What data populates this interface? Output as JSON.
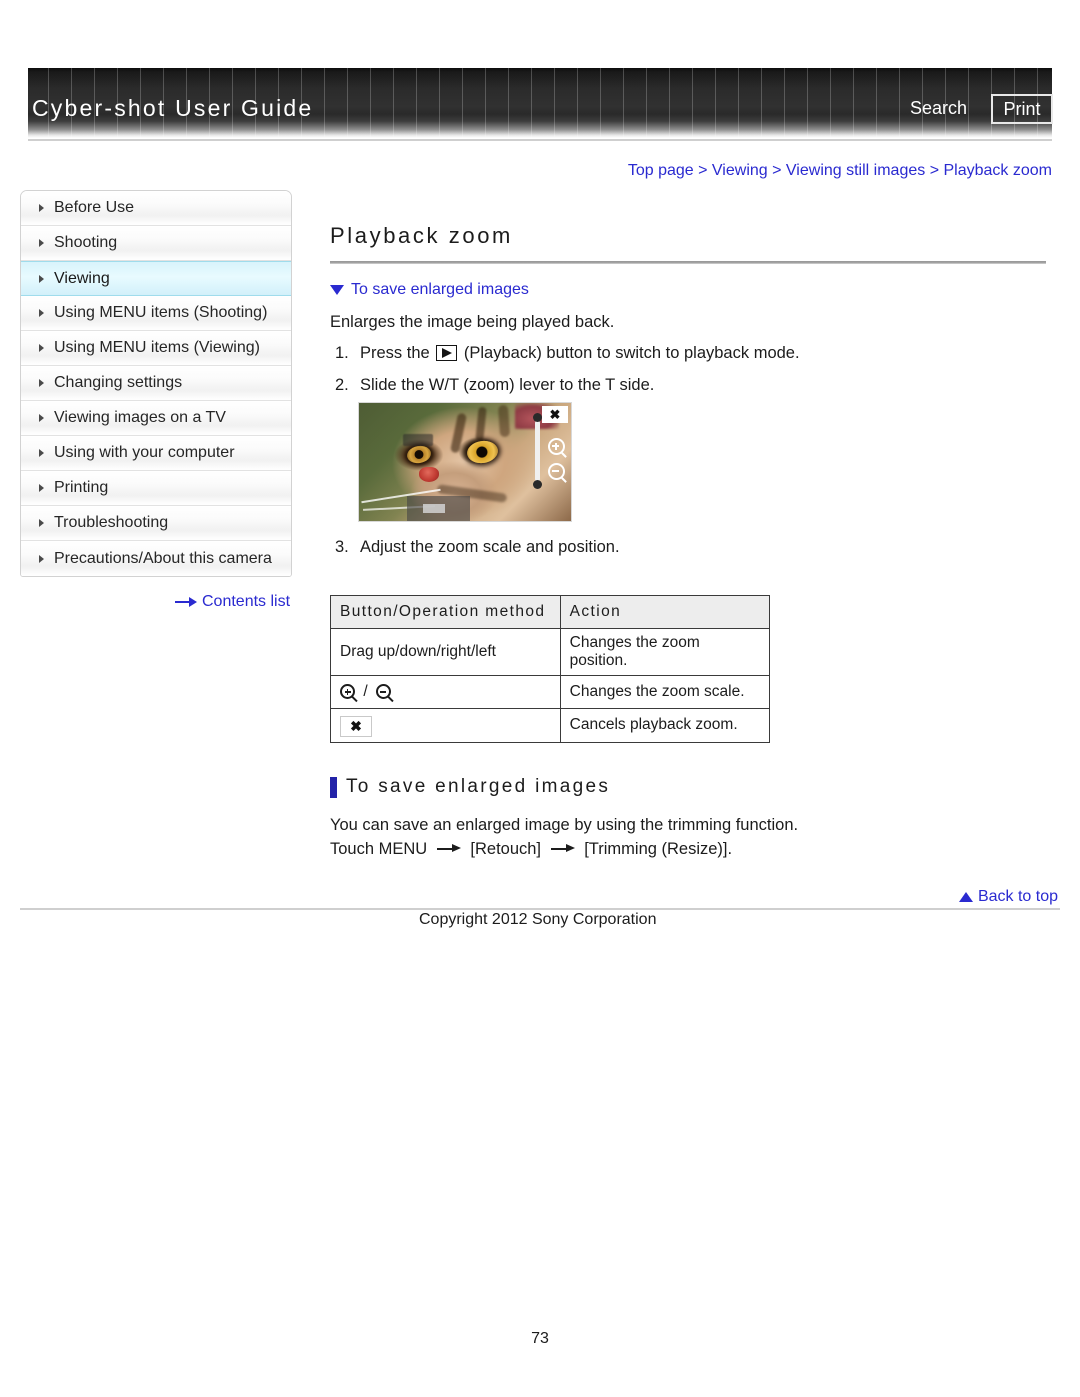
{
  "header": {
    "brand_title": "Cyber-shot User Guide",
    "search_label": "Search",
    "print_label": "Print"
  },
  "breadcrumb": {
    "items": [
      "Top page",
      "Viewing",
      "Viewing still images",
      "Playback zoom"
    ],
    "separator": ">",
    "color": "#2a2ad0"
  },
  "sidebar": {
    "items": [
      {
        "label": "Before Use",
        "active": false
      },
      {
        "label": "Shooting",
        "active": false
      },
      {
        "label": "Viewing",
        "active": true
      },
      {
        "label": "Using MENU items (Shooting)",
        "active": false
      },
      {
        "label": "Using MENU items (Viewing)",
        "active": false
      },
      {
        "label": "Changing settings",
        "active": false
      },
      {
        "label": "Viewing images on a TV",
        "active": false
      },
      {
        "label": "Using with your computer",
        "active": false
      },
      {
        "label": "Printing",
        "active": false
      },
      {
        "label": "Troubleshooting",
        "active": false
      },
      {
        "label": "Precautions/About this camera",
        "active": false
      }
    ],
    "contents_list_label": "Contents list",
    "active_highlight_color": "#d8f3fb"
  },
  "main": {
    "title": "Playback zoom",
    "anchor_link": "To save enlarged images",
    "intro": "Enlarges the image being played back.",
    "steps": [
      {
        "num": "1.",
        "before": "Press the",
        "after": "(Playback) button to switch to playback mode.",
        "has_icon": true
      },
      {
        "num": "2.",
        "before": "Slide the W/T (zoom) lever to the T side.",
        "after": "",
        "has_icon": false
      },
      {
        "num": "3.",
        "before": "Adjust the zoom scale and position.",
        "after": "",
        "has_icon": false
      }
    ],
    "step3_num": "3.",
    "step3_text": "Adjust the zoom scale and position.",
    "camera_screenshot": {
      "close_glyph": "✖",
      "alt": "Playback zoom on camera screen showing enlarged cat photo"
    },
    "table": {
      "headers": [
        "Button/Operation method",
        "Action"
      ],
      "rows": [
        {
          "method_text": "Drag up/down/right/left",
          "method_type": "text",
          "action": "Changes the zoom position."
        },
        {
          "method_text": "",
          "method_type": "magnifiers",
          "action": "Changes the zoom scale."
        },
        {
          "method_text": "",
          "method_type": "close-box",
          "action": "Cancels playback zoom."
        }
      ],
      "mag_separator": "/",
      "close_glyph": "✖"
    },
    "section2": {
      "heading": "To save enlarged images",
      "line1": "You can save an enlarged image by using the trimming function.",
      "line2_a": "Touch MENU",
      "line2_b": "[Retouch]",
      "line2_c": "[Trimming (Resize)]."
    }
  },
  "footer": {
    "back_to_top": "Back to top",
    "copyright": "Copyright 2012 Sony Corporation",
    "page_number": "73"
  }
}
